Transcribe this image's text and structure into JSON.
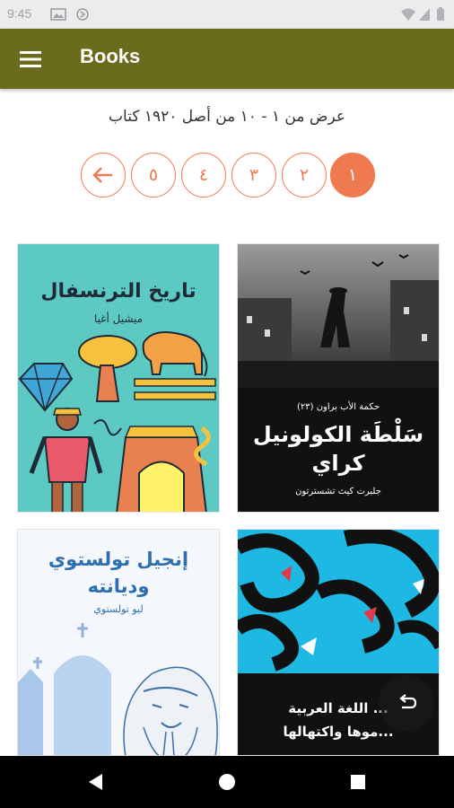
{
  "status_bar": {
    "time": "9:45"
  },
  "app_bar": {
    "title": "Books",
    "color": "#6b6b1e"
  },
  "summary": {
    "text": "عرض من ١ - ١٠ من أصل ١٩٢٠ كتاب"
  },
  "pagination": {
    "accent": "#f07a4f",
    "pages": [
      {
        "label": "١",
        "active": true
      },
      {
        "label": "٢",
        "active": false
      },
      {
        "label": "٣",
        "active": false
      },
      {
        "label": "٤",
        "active": false
      },
      {
        "label": "٥",
        "active": false
      }
    ],
    "next_icon": "arrow-left-icon"
  },
  "books": [
    {
      "title": "تاريخ الترنسفال",
      "author": "ميشيل أغيا",
      "series": "",
      "cover_color": "#5cc9c2"
    },
    {
      "title": "سَلْطَة الكولونيل كراي",
      "author": "جلبرت كيث تشسترتون",
      "series": "حكمة الأب براون (٢٣)",
      "cover_color": "#111111"
    },
    {
      "title": "إنجيل تولستوي وديانته",
      "author": "ليو تولستوي",
      "series": "",
      "cover_color": "#f4f7fb"
    },
    {
      "title": "... اللغة العربية",
      "author": "...موها واكتهالها",
      "series": "",
      "cover_color": "#1db9e3"
    }
  ],
  "fab": {
    "icon": "undo-icon"
  },
  "nav_bar": {
    "back_icon": "back-triangle-icon",
    "home_icon": "home-circle-icon",
    "recents_icon": "recents-square-icon"
  }
}
